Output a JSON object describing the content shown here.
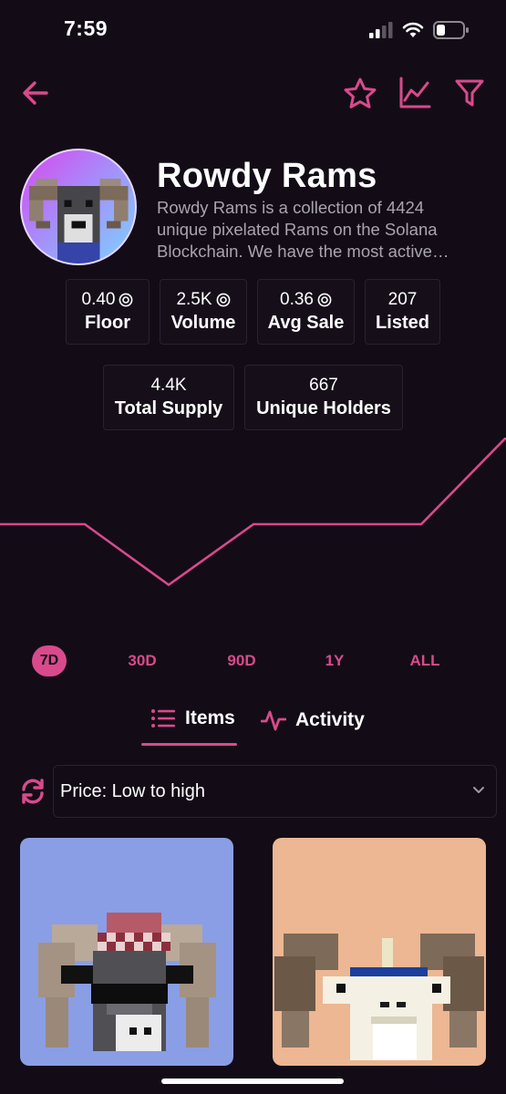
{
  "status_bar": {
    "time": "7:59"
  },
  "collection": {
    "name": "Rowdy Rams",
    "description": "Rowdy Rams is a collection of 4424 unique pixelated Rams on the Solana Blockchain. We have the most active community"
  },
  "stats": [
    {
      "value": "0.40",
      "label": "Floor",
      "currency_icon": true
    },
    {
      "value": "2.5K",
      "label": "Volume",
      "currency_icon": true
    },
    {
      "value": "0.36",
      "label": "Avg Sale",
      "currency_icon": true
    },
    {
      "value": "207",
      "label": "Listed",
      "currency_icon": false
    },
    {
      "value": "4.4K",
      "label": "Total Supply",
      "currency_icon": false
    },
    {
      "value": "667",
      "label": "Unique Holders",
      "currency_icon": false
    }
  ],
  "chart_data": {
    "type": "line",
    "series": [
      {
        "values": [
          0.4,
          0.4,
          0.26,
          0.4,
          0.4,
          0.4,
          0.6
        ]
      }
    ],
    "line_color": "#d94a8c",
    "grid": false
  },
  "ranges": {
    "r7d": "7D",
    "r30d": "30D",
    "r90d": "90D",
    "r1y": "1Y",
    "rall": "ALL",
    "selected": "7D"
  },
  "tabs": {
    "items": "Items",
    "activity": "Activity",
    "selected": "Items"
  },
  "sort": {
    "value": "Price: Low to high"
  },
  "colors": {
    "accent": "#d94a8c",
    "background": "#130c17",
    "card_blue": "#8a9ee6",
    "card_peach": "#ecb792"
  },
  "icons": {
    "back": "arrow-left-icon",
    "favorite": "star-icon",
    "stats": "line-chart-icon",
    "filter": "filter-icon",
    "refresh": "refresh-icon",
    "chevron": "chevron-down-icon",
    "items": "list-icon",
    "activity": "activity-icon"
  }
}
